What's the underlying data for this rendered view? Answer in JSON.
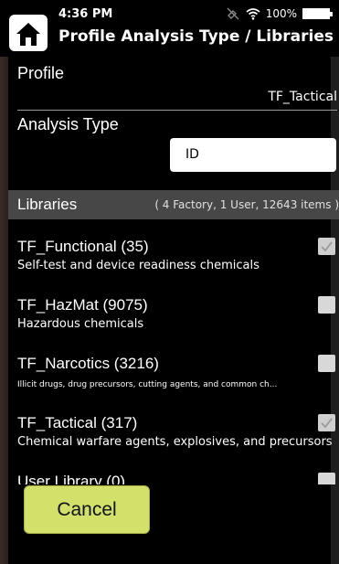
{
  "status": {
    "time": "4:36 PM",
    "battery": "100%",
    "icons": [
      "satellite-off-icon",
      "wifi-icon",
      "battery-icon"
    ]
  },
  "header": {
    "title": "Profile Analysis Type / Libraries",
    "home_icon": "home-icon"
  },
  "profile": {
    "label": "Profile",
    "value": "TF_Tactical"
  },
  "analysis": {
    "label": "Analysis Type",
    "value": "ID"
  },
  "libraries": {
    "title": "Libraries",
    "summary": "( 4 Factory, 1 User, 12643 items )",
    "items": [
      {
        "name": "TF_Functional (35)",
        "description": "Self-test and device readiness chemicals",
        "checked": true
      },
      {
        "name": "TF_HazMat (9075)",
        "description": "Hazardous chemicals",
        "checked": false
      },
      {
        "name": "TF_Narcotics (3216)",
        "description": "Illicit drugs, drug precursors, cutting agents, and common ch...",
        "checked": false
      },
      {
        "name": "TF_Tactical (317)",
        "description": "Chemical warfare agents, explosives, and precursors",
        "checked": true
      },
      {
        "name": "User Library (0)",
        "description": "",
        "checked": false
      }
    ]
  },
  "actions": {
    "cancel_label": "Cancel"
  },
  "colors": {
    "background": "#000000",
    "section_header": "#474747",
    "cancel_button": "#d3e06a"
  }
}
